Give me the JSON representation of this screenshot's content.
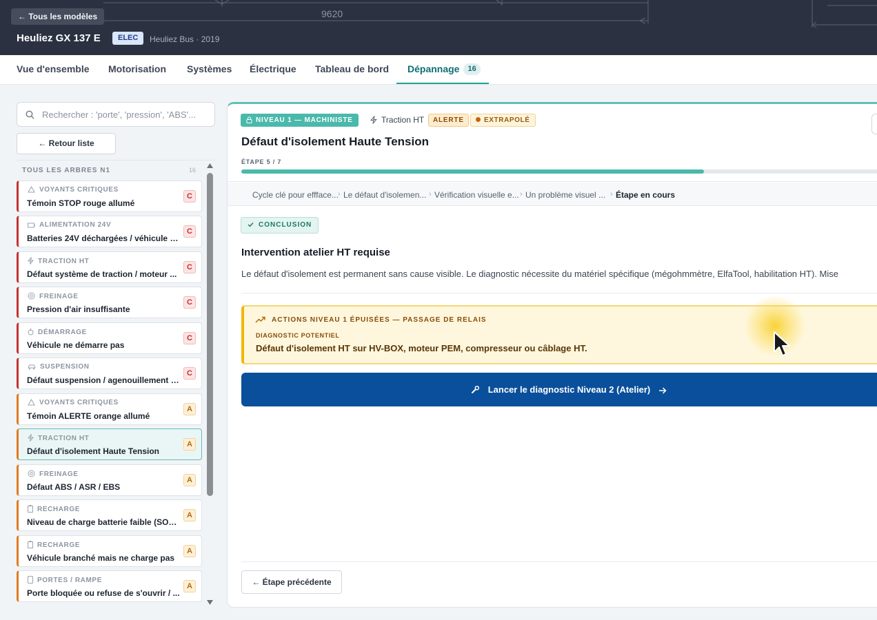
{
  "header": {
    "back_label": "← Tous les modèles",
    "blueprint_dimension": "9620",
    "model_name": "Heuliez GX 137 E",
    "energy_badge": "ELEC",
    "model_sub": "Heuliez Bus · 2019"
  },
  "tabs": [
    {
      "label": "Vue d'ensemble"
    },
    {
      "label": "Motorisation"
    },
    {
      "label": "Systèmes"
    },
    {
      "label": "Électrique"
    },
    {
      "label": "Tableau de bord"
    },
    {
      "label": "Dépannage",
      "count": "16",
      "active": true
    }
  ],
  "sidebar": {
    "search_placeholder": "Rechercher : 'porte', 'pression', 'ABS'...",
    "back_list_label": "← Retour liste",
    "list_title": "TOUS LES ARBRES N1",
    "list_count": "16",
    "items": [
      {
        "category": "VOYANTS CRITIQUES",
        "icon": "warning-triangle-icon",
        "title": "Témoin STOP rouge allumé",
        "severity": "C"
      },
      {
        "category": "ALIMENTATION 24V",
        "icon": "battery-icon",
        "title": "Batteries 24V déchargées / véhicule n...",
        "severity": "C"
      },
      {
        "category": "TRACTION HT",
        "icon": "lightning-icon",
        "title": "Défaut système de traction / moteur ...",
        "severity": "C"
      },
      {
        "category": "FREINAGE",
        "icon": "brake-disc-icon",
        "title": "Pression d'air insuffisante",
        "severity": "C"
      },
      {
        "category": "DÉMARRAGE",
        "icon": "ignition-key-icon",
        "title": "Véhicule ne démarre pas",
        "severity": "C"
      },
      {
        "category": "SUSPENSION",
        "icon": "car-suspension-icon",
        "title": "Défaut suspension / agenouillement i...",
        "severity": "C"
      },
      {
        "category": "VOYANTS CRITIQUES",
        "icon": "warning-triangle-icon",
        "title": "Témoin ALERTE orange allumé",
        "severity": "A"
      },
      {
        "category": "TRACTION HT",
        "icon": "lightning-icon",
        "title": "Défaut d'isolement Haute Tension",
        "severity": "A",
        "selected": true
      },
      {
        "category": "FREINAGE",
        "icon": "brake-disc-icon",
        "title": "Défaut ABS / ASR / EBS",
        "severity": "A"
      },
      {
        "category": "RECHARGE",
        "icon": "charging-battery-icon",
        "title": "Niveau de charge batterie faible (SOC...",
        "severity": "A"
      },
      {
        "category": "RECHARGE",
        "icon": "charging-battery-icon",
        "title": "Véhicule branché mais ne charge pas",
        "severity": "A"
      },
      {
        "category": "PORTES / RAMPE",
        "icon": "door-icon",
        "title": "Porte bloquée ou refuse de s'ouvrir / ...",
        "severity": "A"
      }
    ]
  },
  "panel": {
    "level_badge": "NIVEAU 1 — MACHINISTE",
    "system_tag": "Traction HT",
    "alert_badge": "ALERTE",
    "extrapolated_badge": "EXTRAPOLÉ",
    "title": "Défaut d'isolement Haute Tension",
    "step_label": "ÉTAPE 5 / 7",
    "progress_fraction": 0.714,
    "breadcrumb": [
      "Cycle clé pour effface...",
      "Le défaut d'isolemen...",
      "Vérification visuelle e...",
      "Un problème visuel ...",
      "Étape en cours"
    ],
    "conclusion_badge": "CONCLUSION",
    "intervention_title": "Intervention atelier HT requise",
    "intervention_desc": "Le défaut d'isolement est permanent sans cause visible. Le diagnostic nécessite du matériel spécifique (mégohmmètre, ElfaTool, habilitation HT). Mise",
    "relay": {
      "heading": "ACTIONS NIVEAU 1 ÉPUISÉES — PASSAGE DE RELAIS",
      "sub_label": "DIAGNOSTIC POTENTIEL",
      "text": "Défaut d'isolement HT sur HV-BOX, moteur PEM, compresseur ou câblage HT."
    },
    "launch_label": "Lancer le diagnostic Niveau 2 (Atelier)",
    "prev_label": "← Étape précédente"
  },
  "colors": {
    "header_bg": "#2b3140",
    "teal_accent": "#4ab9ab",
    "critical_red": "#c53030",
    "alert_orange": "#e07b1f",
    "relay_yellow": "#f2b705",
    "launch_blue": "#0a4f9b"
  }
}
